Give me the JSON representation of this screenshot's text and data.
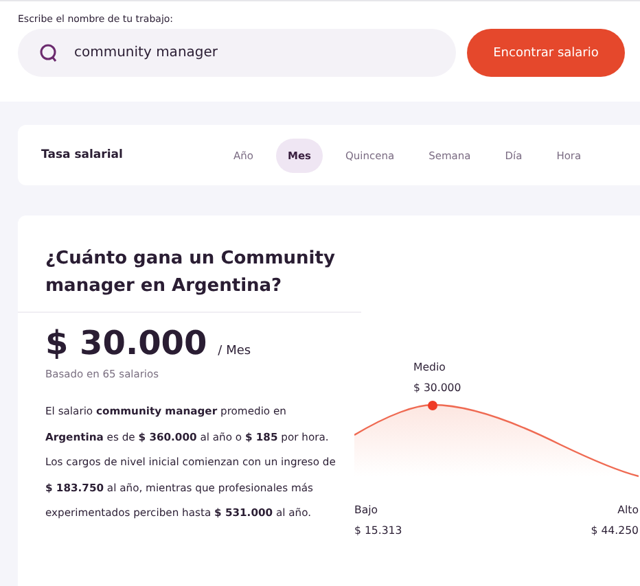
{
  "search": {
    "label": "Escribe el nombre de tu trabajo:",
    "value": "community manager",
    "button": "Encontrar salario"
  },
  "rate": {
    "label": "Tasa salarial",
    "tabs": [
      {
        "label": "Año",
        "selected": false
      },
      {
        "label": "Mes",
        "selected": true
      },
      {
        "label": "Quincena",
        "selected": false
      },
      {
        "label": "Semana",
        "selected": false
      },
      {
        "label": "Día",
        "selected": false
      },
      {
        "label": "Hora",
        "selected": false
      }
    ]
  },
  "salary": {
    "title": "¿Cuánto gana un Community manager en Argentina?",
    "amount": "$ 30.000",
    "period": "/ Mes",
    "basis": "Basado en 65 salarios",
    "description": "El salario **community manager** promedio en **Argentina** es de **$ 360.000** al año o **$ 185** por hora. Los cargos de nivel inicial comienzan con un ingreso de **$ 183.750** al año, mientras que profesionales más experimentados perciben hasta **$ 531.000** al año.",
    "distribution": {
      "median_label": "Medio",
      "median_value": "$ 30.000",
      "low_label": "Bajo",
      "low_value": "$ 15.313",
      "high_label": "Alto",
      "high_value": "$ 44.250"
    }
  }
}
